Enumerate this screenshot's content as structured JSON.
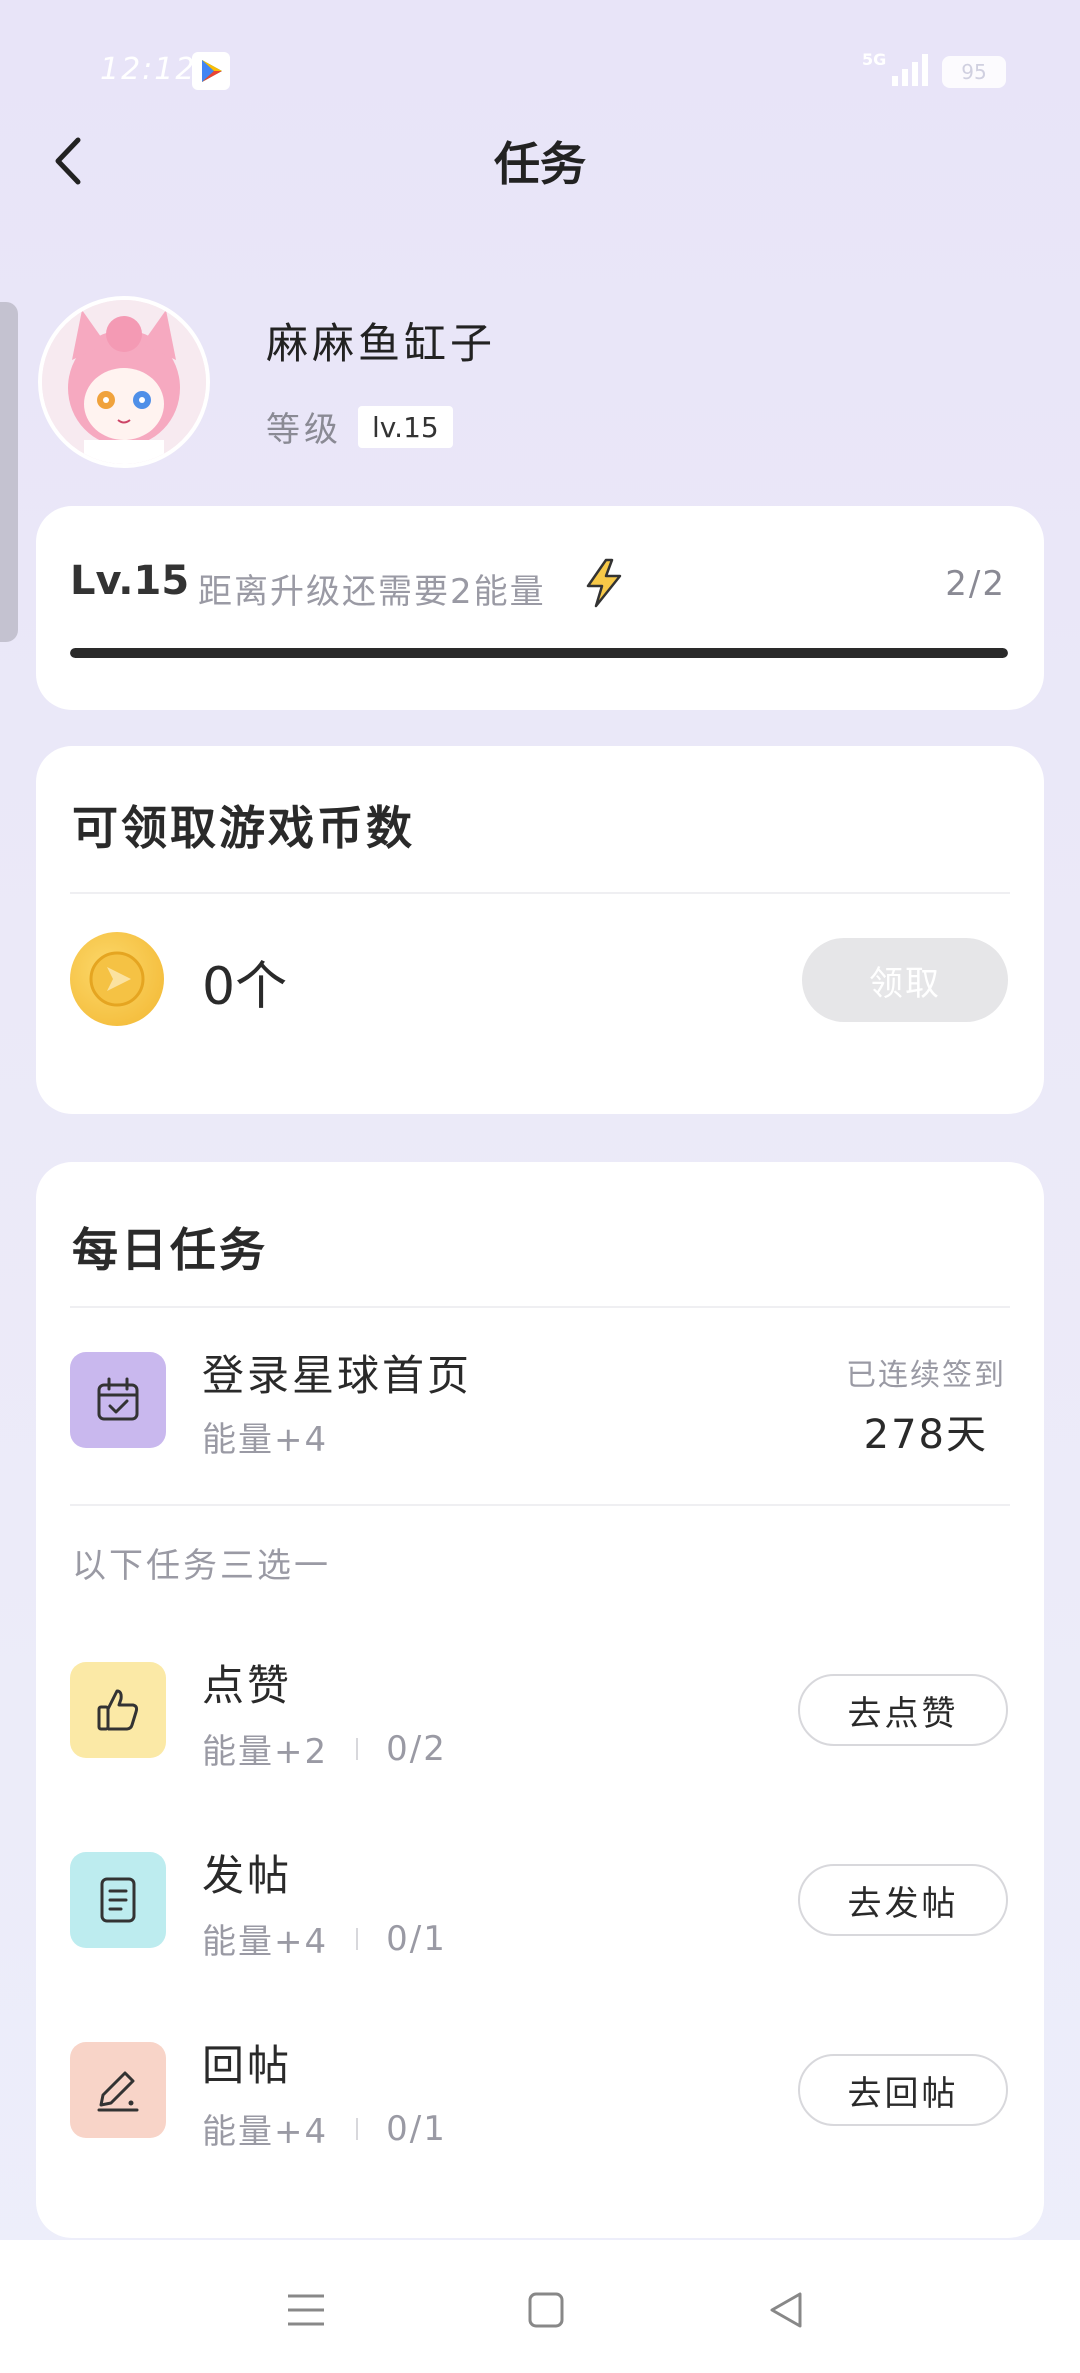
{
  "status_bar": {
    "time": "12:12",
    "network": "5G",
    "battery": "95",
    "icons": [
      "play-store-icon",
      "signal-icon",
      "battery-icon"
    ]
  },
  "header": {
    "title": "任务",
    "back_icon": "chevron-left-icon"
  },
  "profile": {
    "username": "麻麻鱼缸子",
    "level_label": "等级",
    "level_badge": "lv.15"
  },
  "level_card": {
    "level": "Lv.15",
    "description": "距离升级还需要2能量",
    "progress_text": "2/2",
    "progress_fraction": 1.0,
    "bolt_icon": "lightning-icon"
  },
  "coins_card": {
    "title": "可领取游戏币数",
    "count": "0个",
    "claim_label": "领取",
    "coin_icon": "coin-icon"
  },
  "daily_card": {
    "title": "每日任务",
    "login_task": {
      "name": "登录星球首页",
      "reward": "能量+4",
      "streak_label": "已连续签到",
      "streak_value": "278天",
      "icon": "calendar-check-icon"
    },
    "choose_one": "以下任务三选一",
    "tasks": [
      {
        "name": "点赞",
        "reward": "能量+2",
        "progress": "0/2",
        "button": "去点赞",
        "icon": "thumbs-up-icon",
        "icon_bg": "#fbe9a6"
      },
      {
        "name": "发帖",
        "reward": "能量+4",
        "progress": "0/1",
        "button": "去发帖",
        "icon": "document-icon",
        "icon_bg": "#bdecef"
      },
      {
        "name": "回帖",
        "reward": "能量+4",
        "progress": "0/1",
        "button": "去回帖",
        "icon": "pencil-icon",
        "icon_bg": "#f8d4c8"
      }
    ]
  },
  "nav_bar": {
    "icons": [
      "menu-icon",
      "home-square-icon",
      "back-triangle-icon"
    ]
  },
  "colors": {
    "accent_purple": "#c9b8ee",
    "coin_gold": "#f2b630",
    "progress_dark": "#2a2a2a"
  }
}
